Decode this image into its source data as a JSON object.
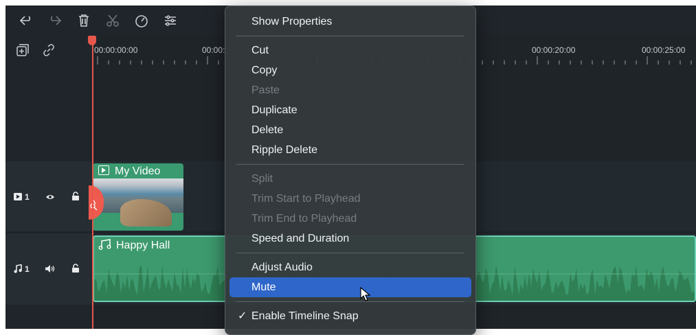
{
  "toolbar": {
    "icons": [
      "undo-icon",
      "redo-icon",
      "delete-icon",
      "cut-icon",
      "speed-icon",
      "adjust-icon"
    ]
  },
  "header": {
    "icons": [
      "add-track-icon",
      "link-icon"
    ]
  },
  "ruler": {
    "labels": [
      "00:00:00:00",
      "00:00:",
      "00:00:20:00",
      "00:00:25:00"
    ]
  },
  "tracks": {
    "video": {
      "label": "1",
      "clip_title": "My Video"
    },
    "audio": {
      "label": "1",
      "clip_title": "Happy Hall"
    }
  },
  "context_menu": {
    "items": [
      {
        "label": "Show Properties",
        "enabled": true
      },
      {
        "label": "Cut",
        "enabled": true
      },
      {
        "label": "Copy",
        "enabled": true
      },
      {
        "label": "Paste",
        "enabled": false
      },
      {
        "label": "Duplicate",
        "enabled": true
      },
      {
        "label": "Delete",
        "enabled": true
      },
      {
        "label": "Ripple Delete",
        "enabled": true
      },
      {
        "label": "Split",
        "enabled": false
      },
      {
        "label": "Trim Start to Playhead",
        "enabled": false
      },
      {
        "label": "Trim End to Playhead",
        "enabled": false
      },
      {
        "label": "Speed and Duration",
        "enabled": true
      },
      {
        "label": "Adjust Audio",
        "enabled": true
      },
      {
        "label": "Mute",
        "enabled": true,
        "highlighted": true
      },
      {
        "label": "Enable Timeline Snap",
        "enabled": true,
        "checked": true,
        "check_mark": "✓"
      }
    ]
  },
  "colors": {
    "background": "#1f2429",
    "clip_green": "#3a9a70",
    "audio_border": "#6fd3b8",
    "playhead": "#e4574a",
    "menu_highlight": "#2f66c9"
  }
}
